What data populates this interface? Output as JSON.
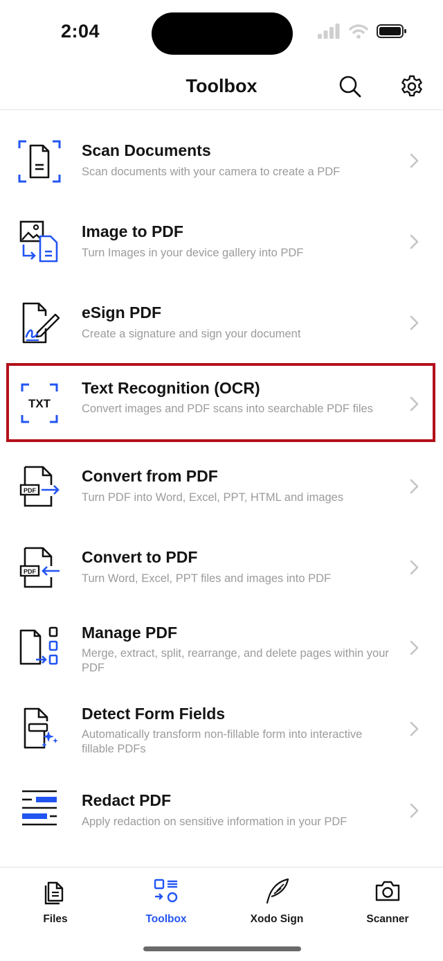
{
  "status_bar": {
    "time": "2:04"
  },
  "header": {
    "title": "Toolbox"
  },
  "tools": [
    {
      "title": "Scan Documents",
      "description": "Scan documents with your camera to create a PDF"
    },
    {
      "title": "Image to PDF",
      "description": "Turn Images in your device gallery into PDF"
    },
    {
      "title": "eSign PDF",
      "description": "Create a signature and sign your document"
    },
    {
      "title": "Text Recognition (OCR)",
      "description": "Convert images and PDF scans into searchable PDF files",
      "icon_text": "TXT",
      "highlighted": true
    },
    {
      "title": "Convert from PDF",
      "description": "Turn PDF into Word, Excel, PPT, HTML and images",
      "icon_text": "PDF"
    },
    {
      "title": "Convert to PDF",
      "description": "Turn Word, Excel, PPT files and images into PDF",
      "icon_text": "PDF"
    },
    {
      "title": "Manage PDF",
      "description": "Merge, extract, split, rearrange, and delete pages within your PDF"
    },
    {
      "title": "Detect Form Fields",
      "description": "Automatically transform non-fillable form into interactive fillable PDFs"
    },
    {
      "title": "Redact PDF",
      "description": "Apply redaction on sensitive information in your PDF"
    }
  ],
  "tabs": [
    {
      "label": "Files",
      "icon": "files-icon"
    },
    {
      "label": "Toolbox",
      "icon": "toolbox-icon",
      "active": true
    },
    {
      "label": "Xodo Sign",
      "icon": "quill-icon"
    },
    {
      "label": "Scanner",
      "icon": "camera-icon"
    }
  ],
  "colors": {
    "accent": "#2254f2",
    "highlight_border": "#b3101a",
    "text": "#141414",
    "subtext": "#9b9b9b"
  }
}
